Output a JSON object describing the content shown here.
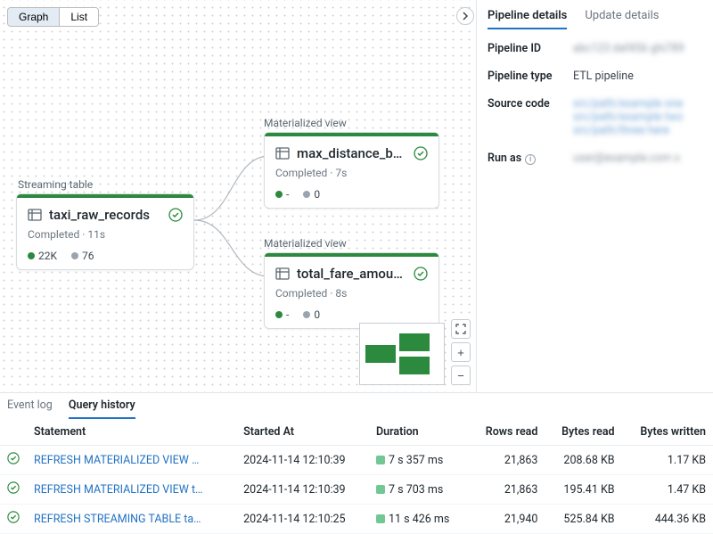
{
  "view_toggle": {
    "graph": "Graph",
    "list": "List"
  },
  "nodes": {
    "root": {
      "label": "Streaming table",
      "title": "taxi_raw_records",
      "status": "Completed · 11s",
      "stat_green": "22K",
      "stat_grey": "76"
    },
    "max": {
      "label": "Materialized view",
      "title": "max_distance_by_…",
      "status": "Completed · 7s",
      "stat_green": "-",
      "stat_grey": "0"
    },
    "total": {
      "label": "Materialized view",
      "title": "total_fare_amount…",
      "status": "Completed · 8s",
      "stat_green": "-",
      "stat_grey": "0"
    }
  },
  "details": {
    "tabs": {
      "pipeline": "Pipeline details",
      "update": "Update details"
    },
    "rows": {
      "pipeline_id": {
        "label": "Pipeline ID",
        "value": "abc123 def456 ghi789"
      },
      "pipeline_type": {
        "label": "Pipeline type",
        "value": "ETL pipeline"
      },
      "source_code": {
        "label": "Source code",
        "value": "src/path/example one\nsrc/path/example two\nsrc/path/three here"
      },
      "run_as": {
        "label": "Run as",
        "value": "user@example.com x"
      }
    }
  },
  "bottom_tabs": {
    "event": "Event log",
    "query": "Query history"
  },
  "query_history": {
    "headers": {
      "statement": "Statement",
      "started": "Started At",
      "duration": "Duration",
      "rows": "Rows read",
      "bytes_read": "Bytes read",
      "bytes_written": "Bytes written"
    },
    "rows": [
      {
        "stmt": "REFRESH MATERIALIZED VIEW max_di…",
        "started": "2024-11-14 12:10:39",
        "duration": "7 s 357 ms",
        "rows": "21,863",
        "bread": "208.68 KB",
        "bwrit": "1.17 KB"
      },
      {
        "stmt": "REFRESH MATERIALIZED VIEW total_fa…",
        "started": "2024-11-14 12:10:39",
        "duration": "7 s 703 ms",
        "rows": "21,863",
        "bread": "195.41 KB",
        "bwrit": "1.47 KB"
      },
      {
        "stmt": "REFRESH STREAMING TABLE taxi_raw…",
        "started": "2024-11-14 12:10:25",
        "duration": "11 s 426 ms",
        "rows": "21,940",
        "bread": "525.84 KB",
        "bwrit": "444.36 KB"
      }
    ]
  }
}
